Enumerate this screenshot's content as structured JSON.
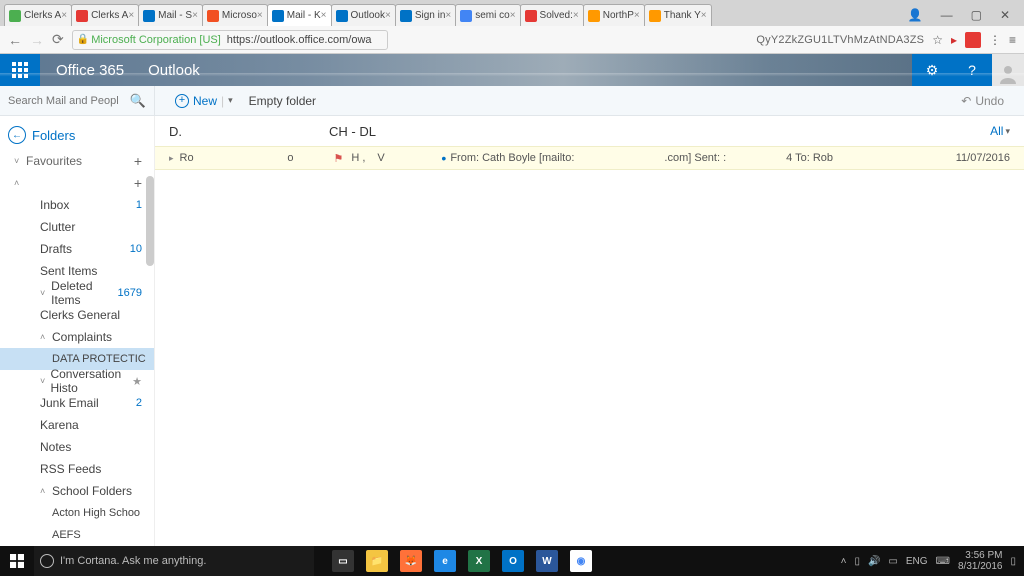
{
  "browser": {
    "tabs": [
      {
        "label": "Clerks A",
        "color": "#4caf50"
      },
      {
        "label": "Clerks A",
        "color": "#e53935"
      },
      {
        "label": "Mail - S",
        "color": "#0072c6"
      },
      {
        "label": "Microso",
        "color": "#f25022"
      },
      {
        "label": "Mail - K",
        "color": "#0072c6",
        "active": true
      },
      {
        "label": "Outlook",
        "color": "#0072c6"
      },
      {
        "label": "Sign in",
        "color": "#0072c6"
      },
      {
        "label": "semi co",
        "color": "#4285f4"
      },
      {
        "label": "Solved:",
        "color": "#e53935"
      },
      {
        "label": "NorthP",
        "color": "#ff9900"
      },
      {
        "label": "Thank Y",
        "color": "#ff9900"
      }
    ],
    "url_corp": "Microsoft Corporation [US]",
    "url_path": "https://outlook.office.com/owa",
    "query_string": "QyY2ZkZGU1LTVhMzAtNDA3ZS",
    "win_min": "—",
    "win_max": "▢",
    "win_close": "✕"
  },
  "owa": {
    "brand": "Office 365",
    "app": "Outlook",
    "gear": "⚙",
    "help": "?"
  },
  "toolbar": {
    "search_placeholder": "Search Mail and People",
    "new_label": "New",
    "empty_label": "Empty folder",
    "undo_label": "Undo"
  },
  "sidebar": {
    "folders_label": "Folders",
    "fav_label": "Favourites",
    "items": [
      {
        "label": "Inbox",
        "count": "1"
      },
      {
        "label": "Clutter"
      },
      {
        "label": "Drafts",
        "count": "10"
      },
      {
        "label": "Sent Items"
      },
      {
        "label": "Deleted Items",
        "count": "1679",
        "chev": "˅"
      },
      {
        "label": "Clerks General"
      },
      {
        "label": "Complaints",
        "chev": "˄"
      },
      {
        "label": "DATA PROTECTIC",
        "selected": true,
        "indent": 2
      },
      {
        "label": "Conversation Histo",
        "chev": "˅",
        "star": true
      },
      {
        "label": "Junk Email",
        "count": "2"
      },
      {
        "label": "Karena"
      },
      {
        "label": "Notes"
      },
      {
        "label": "RSS Feeds"
      },
      {
        "label": "School Folders",
        "chev": "˄"
      },
      {
        "label": "Acton High Schoo",
        "indent": 2
      },
      {
        "label": "AEFS",
        "indent": 2
      }
    ]
  },
  "list": {
    "col_d": "D.",
    "col_ch": "CH - DL",
    "all_label": "All",
    "msg": {
      "sender": "Ro",
      "sender2": "o",
      "subj_a": "H ,",
      "subj_b": "V",
      "from_label": "From: Cath Boyle [mailto:",
      "domain": ".com] Sent: :",
      "to": "4 To: Rob",
      "date": "11/07/2016"
    }
  },
  "taskbar": {
    "cortana": "I'm Cortana. Ask me anything.",
    "lang": "ENG",
    "time": "3:56 PM",
    "date": "8/31/2016"
  }
}
